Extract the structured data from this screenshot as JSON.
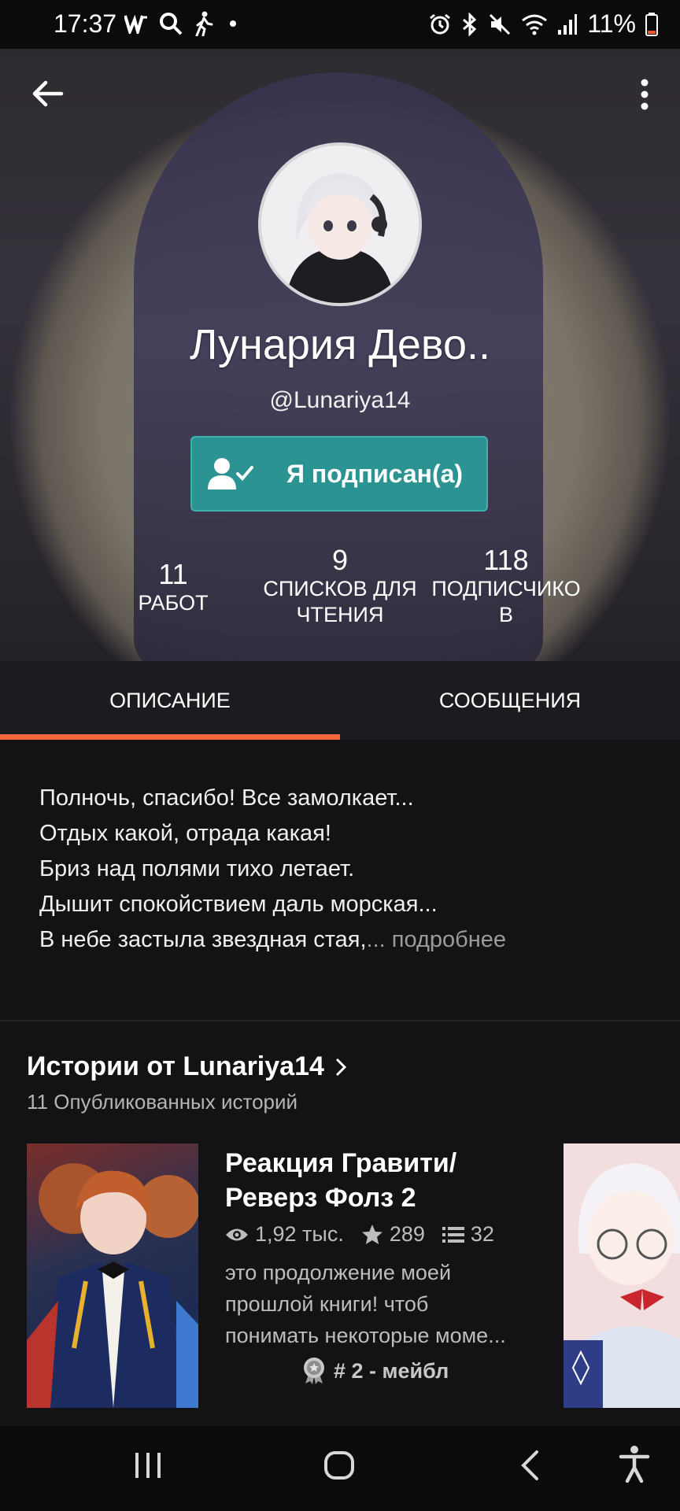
{
  "status_bar": {
    "time": "17:37",
    "battery": "11%",
    "icons_left": [
      "w-icon",
      "search-icon",
      "walk-icon",
      "dot"
    ],
    "icons_right": [
      "alarm-icon",
      "bluetooth-icon",
      "mute-icon",
      "wifi-icon",
      "signal-icon",
      "battery-icon"
    ]
  },
  "profile": {
    "display_name": "Лунария Дево..",
    "username": "@Lunariya14",
    "follow_button": "Я подписан(а)",
    "stats": [
      {
        "value": "11",
        "label": "РАБОТ"
      },
      {
        "value": "9",
        "label_line1": "СПИСКОВ ДЛЯ",
        "label_line2": "ЧТЕНИЯ"
      },
      {
        "value": "118",
        "label_line1": "ПОДПИСЧИКО",
        "label_line2": "В"
      }
    ]
  },
  "tabs": [
    {
      "label": "ОПИСАНИЕ",
      "active": true
    },
    {
      "label": "СООБЩЕНИЯ",
      "active": false
    }
  ],
  "description": {
    "lines": [
      "Полночь, спасибо! Все замолкает...",
      "Отдых какой, отрада какая!",
      "Бриз над полями тихо летает.",
      "Дышит спокойствием даль морская...",
      "В небе застыла звездная стая,"
    ],
    "ellipsis": "...",
    "more_link": " подробнее"
  },
  "stories": {
    "title": "Истории от Lunariya14",
    "subtitle": "11 Опубликованных историй",
    "items": [
      {
        "title_line1": "Реакция Гравити/",
        "title_line2": "Реверз Фолз 2",
        "views": "1,92 тыс.",
        "votes": "289",
        "parts": "32",
        "desc_line1": "это продолжение моей",
        "desc_line2": "прошлой книги! чтоб",
        "desc_line3": "понимать некоторые моме...",
        "badge": "# 2 - мейбл"
      }
    ]
  },
  "colors": {
    "accent": "#f2683a",
    "follow_button": "#2b9391",
    "background": "#131215"
  }
}
